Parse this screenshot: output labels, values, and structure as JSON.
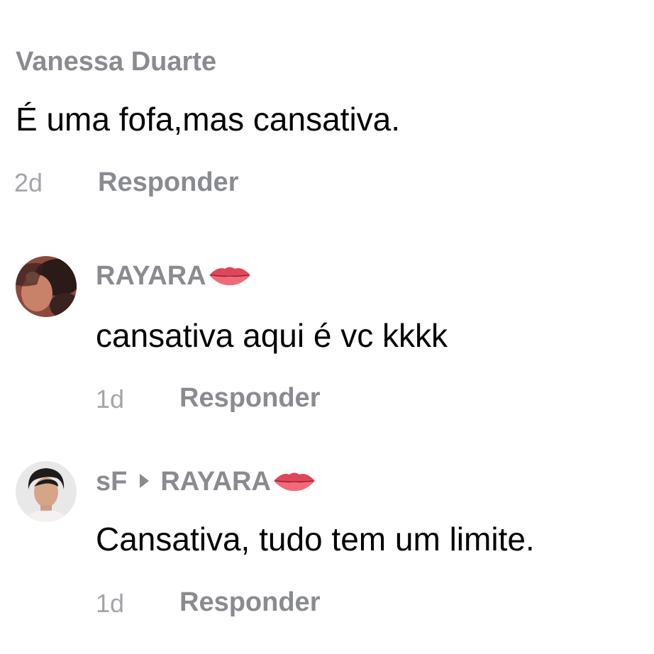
{
  "comments": [
    {
      "username": "Vanessa Duarte",
      "text": "É uma fofa,mas cansativa.",
      "time": "2d",
      "reply_label": "Responder"
    },
    {
      "username": "RAYARA",
      "username_icon": "lips-icon",
      "text": "cansativa aqui é vc kkkk",
      "time": "1d",
      "reply_label": "Responder"
    },
    {
      "username": "sF",
      "reply_to": "RAYARA",
      "reply_to_icon": "lips-icon",
      "text": "Cansativa, tudo tem um limite.",
      "time": "1d",
      "reply_label": "Responder"
    }
  ],
  "colors": {
    "username": "#8a8b91",
    "body_text": "#000000",
    "timestamp": "#a4a5aa",
    "lips": "#e0465a"
  }
}
